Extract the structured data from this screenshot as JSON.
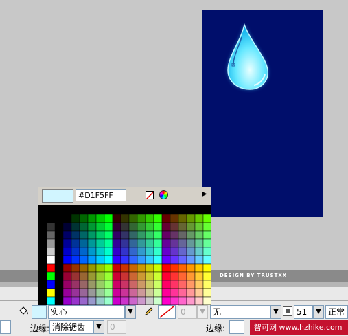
{
  "canvas": {
    "bg_color": "#000e6b",
    "credit_text": "DESIGN BY TRUSTXX"
  },
  "palette": {
    "current_color": "#D1F5FF",
    "hex_value": "#D1F5FF",
    "icons": [
      "no-color-icon",
      "color-wheel-icon",
      "palette-menu-arrow-icon"
    ]
  },
  "fill_row": {
    "fill_type": "实心",
    "outline_thickness": "0",
    "stroke_style": "无",
    "alpha_value": "51",
    "blend_mode": "正常"
  },
  "edge_row": {
    "edge_label_left": "边缘:",
    "edge_value_left": "消除锯齿",
    "edge_number": "0",
    "edge_label_right": "边缘:"
  },
  "watermark": {
    "text": "智可网 www.hzhike.com"
  }
}
